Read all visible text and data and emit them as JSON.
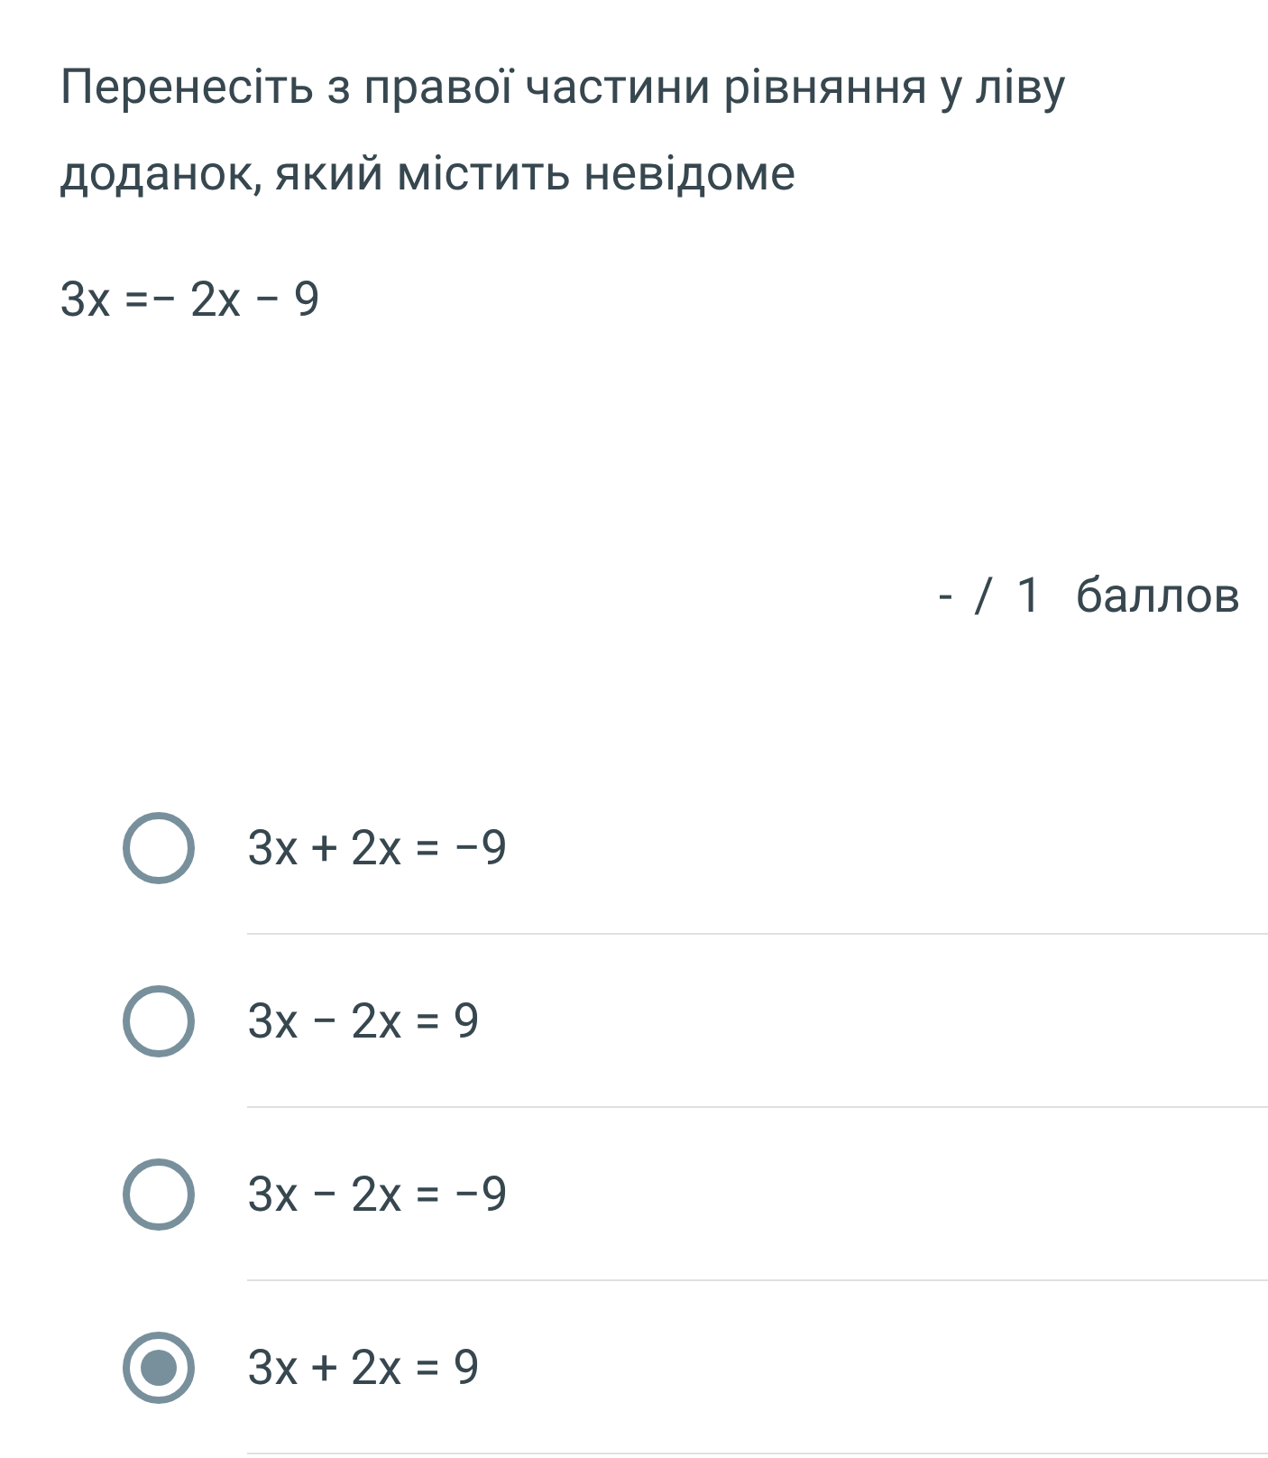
{
  "question": {
    "text": "Перенесіть з правої частини рівняння у ліву доданок, який містить невідоме",
    "equation": "3x =− 2x − 9"
  },
  "score": {
    "earned": "-",
    "separator": "/",
    "total": "1",
    "unit": "баллов"
  },
  "options": [
    {
      "label": "3x + 2x = −9",
      "selected": false
    },
    {
      "label": "3x − 2x = 9",
      "selected": false
    },
    {
      "label": "3x − 2x = −9",
      "selected": false
    },
    {
      "label": "3x + 2x = 9",
      "selected": true
    }
  ]
}
